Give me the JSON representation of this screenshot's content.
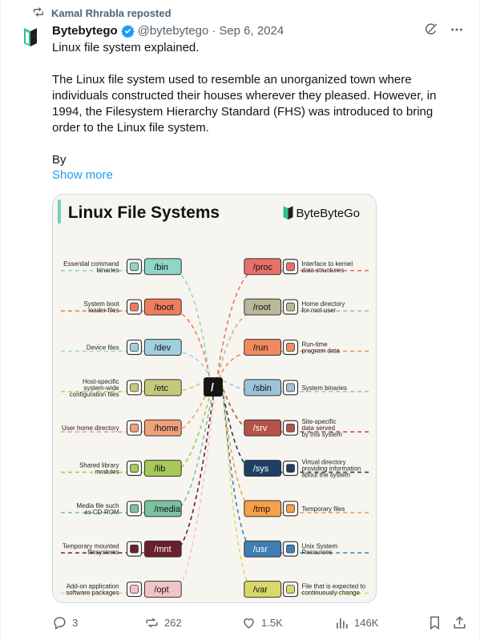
{
  "repost": {
    "label": "Kamal Rhrabla reposted",
    "icon": "repost-icon"
  },
  "author": {
    "name": "Bytebytego",
    "handle": "@bytebytego",
    "separator": "·",
    "date": "Sep 6, 2024",
    "verified": true,
    "verified_color": "#1d9bf0"
  },
  "tweet": {
    "line1": "Linux file system explained.",
    "para2": "The Linux file system used to resemble an unorganized town where individuals constructed their houses wherever they pleased. However, in 1994, the Filesystem Hierarchy Standard (FHS) was introduced to bring order to the Linux file system.",
    "para3": "By",
    "show_more": "Show more"
  },
  "infographic": {
    "title": "Linux File Systems",
    "brand": "ByteByteGo",
    "root": "/",
    "left": [
      {
        "dir": "/bin",
        "desc": [
          "Essential command",
          "binaries"
        ],
        "color": "#8fd6c6",
        "icon": "exe-file-icon"
      },
      {
        "dir": "/boot",
        "desc": [
          "System boot",
          "loader files"
        ],
        "color": "#ee7d5e",
        "icon": "gear-icon"
      },
      {
        "dir": "/dev",
        "desc": [
          "Device files"
        ],
        "color": "#9fcfe0",
        "icon": "device-icon"
      },
      {
        "dir": "/etc",
        "desc": [
          "Host-specific",
          "system-wide",
          "configuration files"
        ],
        "color": "#c7c97a",
        "icon": "config-icon"
      },
      {
        "dir": "/home",
        "desc": [
          "User home directory"
        ],
        "color": "#f0a07a",
        "icon": "house-icon"
      },
      {
        "dir": "/lib",
        "desc": [
          "Shared library",
          "modules"
        ],
        "color": "#a7c95a",
        "icon": "books-icon"
      },
      {
        "dir": "/media",
        "desc": [
          "Media file such",
          "as CD-ROM"
        ],
        "color": "#7cc2a0",
        "icon": "cd-icon"
      },
      {
        "dir": "/mnt",
        "desc": [
          "Temporary mounted",
          "filesystems"
        ],
        "color": "#6a1f2e",
        "icon": "usb-icon"
      },
      {
        "dir": "/opt",
        "desc": [
          "Add-on application",
          "software packages"
        ],
        "color": "#f2c4c8",
        "icon": "package-icon"
      }
    ],
    "right": [
      {
        "dir": "/proc",
        "desc": [
          "Interface to kernel",
          "data structures"
        ],
        "color": "#e8706a",
        "icon": "interface-icon"
      },
      {
        "dir": "/root",
        "desc": [
          "Home directory",
          "for root user"
        ],
        "color": "#b8b89a",
        "icon": "root-home-icon"
      },
      {
        "dir": "/run",
        "desc": [
          "Run-time",
          "program data"
        ],
        "color": "#f08a5d",
        "icon": "database-icon"
      },
      {
        "dir": "/sbin",
        "desc": [
          "System binaries"
        ],
        "color": "#9cc3d8",
        "icon": "binaries-icon"
      },
      {
        "dir": "/srv",
        "desc": [
          "Site-specific",
          "data served",
          "by this system"
        ],
        "color": "#b5534a",
        "icon": "layers-icon"
      },
      {
        "dir": "/sys",
        "desc": [
          "Virtual directory",
          "providing information",
          "about the system"
        ],
        "color": "#1f3f63",
        "icon": "virtual-dir-icon"
      },
      {
        "dir": "/tmp",
        "desc": [
          "Temporary files"
        ],
        "color": "#f5a04a",
        "icon": "temp-file-icon"
      },
      {
        "dir": "/usr",
        "desc": [
          "Unix System",
          "Resources"
        ],
        "color": "#3f7fb5",
        "icon": "resources-icon"
      },
      {
        "dir": "/var",
        "desc": [
          "File that is expected to",
          "continuously change"
        ],
        "color": "#d9d96a",
        "icon": "variable-file-icon"
      }
    ]
  },
  "stats": {
    "replies": "3",
    "reposts": "262",
    "likes": "1.5K",
    "views": "146K"
  }
}
